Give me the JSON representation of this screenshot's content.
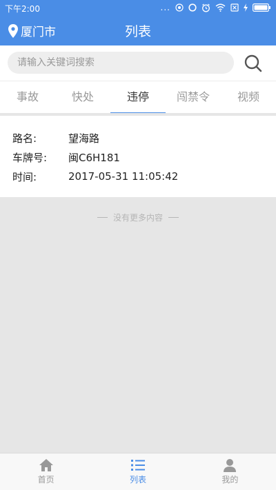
{
  "status_bar": {
    "time": "下午2:00",
    "dots": "..."
  },
  "app_bar": {
    "city": "厦门市",
    "title": "列表"
  },
  "search": {
    "placeholder": "请输入关键词搜索"
  },
  "tabs": [
    {
      "label": "事故"
    },
    {
      "label": "快处"
    },
    {
      "label": "违停"
    },
    {
      "label": "闯禁令"
    },
    {
      "label": "视频"
    }
  ],
  "active_tab": "违停",
  "record": {
    "road_label": "路名:",
    "road_value": "望海路",
    "plate_label": "车牌号:",
    "plate_value": "闽C6H181",
    "time_label": "时间:",
    "time_value": "2017-05-31 11:05:42"
  },
  "list_footer": {
    "no_more": "没有更多内容"
  },
  "bottom_nav": [
    {
      "label": "首页",
      "icon": "home-icon"
    },
    {
      "label": "列表",
      "icon": "list-icon"
    },
    {
      "label": "我的",
      "icon": "person-icon"
    }
  ],
  "colors": {
    "primary": "#4a8de6",
    "text": "#222222",
    "inactive": "#999999",
    "background": "#e6e6e6"
  }
}
